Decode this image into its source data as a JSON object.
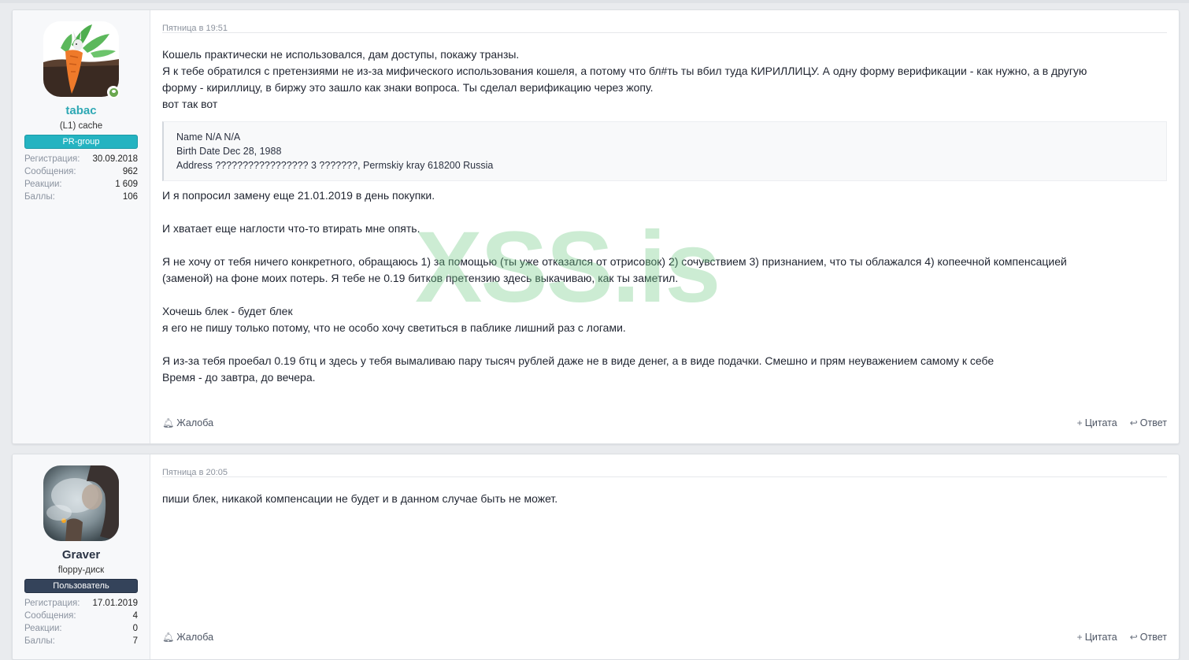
{
  "watermark": "XSS.is",
  "posts": [
    {
      "user": {
        "name": "tabac",
        "title": "(L1) cache",
        "banner": "PR-group",
        "stats": [
          {
            "label": "Регистрация:",
            "value": "30.09.2018"
          },
          {
            "label": "Сообщения:",
            "value": "962"
          },
          {
            "label": "Реакции:",
            "value": "1 609"
          },
          {
            "label": "Баллы:",
            "value": "106"
          }
        ]
      },
      "date": "Пятница в 19:51",
      "lines": [
        "Кошель практически не использовался, дам доступы, покажу транзы.",
        "Я к тебе обратился с претензиями не из-за мифического использования кошеля, а потому что бл#ть ты вбил туда КИРИЛЛИЦУ. А одну форму верификации - как нужно, а в другую",
        "форму - кириллицу, в биржу это зашло как знаки вопроса. Ты сделал верификацию через жопу.",
        "вот так вот"
      ],
      "quote": [
        "Name N/A N/A",
        "Birth Date Dec 28, 1988",
        "Address ????????????????? 3 ???????, Permskiy kray 618200 Russia"
      ],
      "after": [
        "И я попросил замену еще 21.01.2019 в день покупки.",
        "",
        "И хватает еще наглости что-то втирать мне опять.",
        "",
        "Я не хочу от тебя ничего конкретного, обращаюсь 1) за помощью (ты уже отказался от отрисовок) 2) сочувствием 3) признанием, что ты облажался 4) копеечной компенсацией",
        "(заменой) на фоне моих потерь. Я тебе не 0.19 битков претензию здесь выкачиваю, как ты заметил.",
        "",
        "Хочешь блек - будет блек",
        "я его не пишу только потому, что не особо хочу светиться в паблике лишний раз с логами.",
        "",
        "Я из-за тебя проебал 0.19 бтц и здесь у тебя вымаливаю пару тысяч рублей даже не в виде денег, а в виде подачки. Смешно и прям неуважением самому к себе",
        "Время - до завтра, до вечера."
      ],
      "actions": {
        "report": "Жалоба",
        "quote": "Цитата",
        "reply": "Ответ"
      }
    },
    {
      "user": {
        "name": "Graver",
        "title": "floppy-диск",
        "banner": "Пользователь",
        "stats": [
          {
            "label": "Регистрация:",
            "value": "17.01.2019"
          },
          {
            "label": "Сообщения:",
            "value": "4"
          },
          {
            "label": "Реакции:",
            "value": "0"
          },
          {
            "label": "Баллы:",
            "value": "7"
          }
        ]
      },
      "date": "Пятница в 20:05",
      "lines": [
        "пиши блек, никакой компенсации не будет и в данном случае быть не может."
      ],
      "actions": {
        "report": "Жалоба",
        "quote": "Цитата",
        "reply": "Ответ"
      }
    }
  ]
}
